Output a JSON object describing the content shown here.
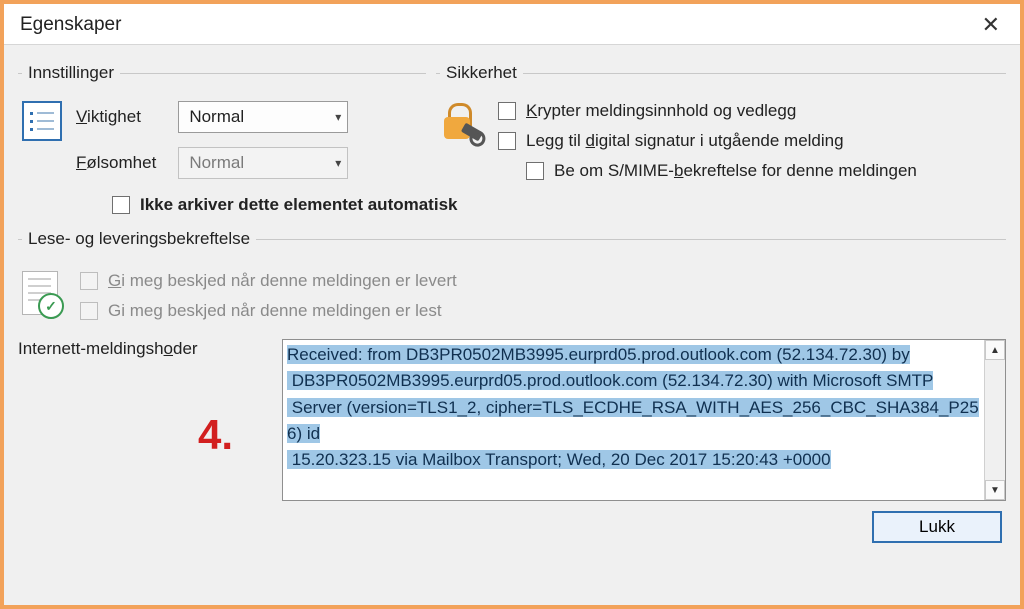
{
  "window": {
    "title": "Egenskaper"
  },
  "settings": {
    "legend": "Innstillinger",
    "importance_label_pre": "V",
    "importance_label_post": "iktighet",
    "sensitivity_label_pre": "F",
    "sensitivity_label_post": "ølsomhet",
    "importance_value": "Normal",
    "sensitivity_value": "Normal",
    "archive_label": "Ikke arkiver dette elementet automatisk"
  },
  "security": {
    "legend": "Sikkerhet",
    "encrypt_pre": "K",
    "encrypt_post": "rypter meldingsinnhold og vedlegg",
    "sign_pre": "Legg til ",
    "sign_u": "d",
    "sign_post": "igital signatur i utgående melding",
    "smime_pre": "Be om S/MIME-",
    "smime_u": "b",
    "smime_post": "ekreftelse for denne meldingen"
  },
  "receipts": {
    "legend": "Lese- og leveringsbekreftelse",
    "delivered_pre": "G",
    "delivered_post": "i meg beskjed når denne meldingen er levert",
    "read": "Gi meg beskjed når denne meldingen er lest"
  },
  "headers": {
    "label_pre": "Internett-meldingsh",
    "label_u": "o",
    "label_post": "der",
    "text": "Received: from DB3PR0502MB3995.eurprd05.prod.outlook.com (52.134.72.30) by\n DB3PR0502MB3995.eurprd05.prod.outlook.com (52.134.72.30) with Microsoft SMTP\n Server (version=TLS1_2, cipher=TLS_ECDHE_RSA_WITH_AES_256_CBC_SHA384_P256) id\n 15.20.323.15 via Mailbox Transport; Wed, 20 Dec 2017 15:20:43 +0000"
  },
  "annotation": {
    "step": "4."
  },
  "footer": {
    "close": "Lukk"
  }
}
